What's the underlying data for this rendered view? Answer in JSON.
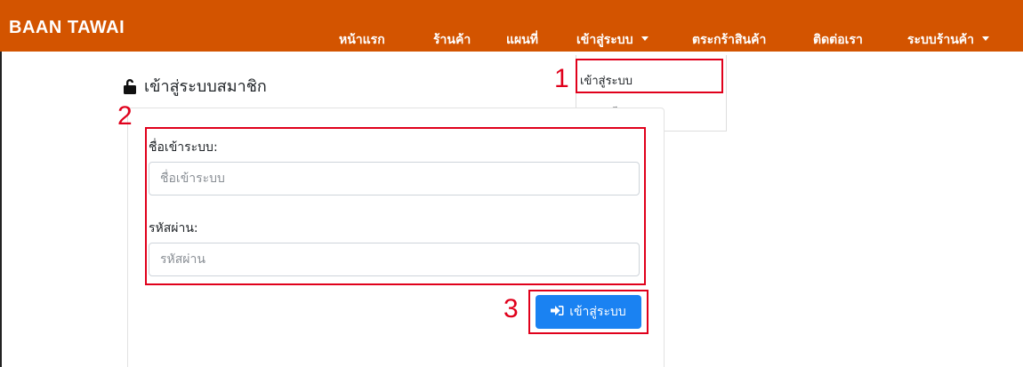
{
  "brand": "BAAN TAWAI",
  "nav": {
    "home": "หน้าแรก",
    "shop": "ร้านค้า",
    "map": "แผนที่",
    "login": "เข้าสู่ระบบ",
    "cart": "ตระกร้าสินค้า",
    "contact": "ติดต่อเรา",
    "store_system": "ระบบร้านค้า"
  },
  "dropdown": {
    "login": "เข้าสู่ระบบ",
    "register": "ลงทะเบียน"
  },
  "page": {
    "heading": "เข้าสู่ระบบสมาชิก"
  },
  "form": {
    "username_label": "ชื่อเข้าระบบ:",
    "username_placeholder": "ชื่อเข้าระบบ",
    "password_label": "รหัสผ่าน:",
    "password_placeholder": "รหัสผ่าน",
    "submit_label": "เข้าสู่ระบบ"
  },
  "annotations": {
    "step1": "1",
    "step2": "2",
    "step3": "3",
    "color": "#e0001b"
  },
  "colors": {
    "navbar": "#d35400",
    "primary_button": "#1a82f2"
  },
  "icons": {
    "heading": "unlock-icon",
    "submit": "sign-in-icon"
  }
}
